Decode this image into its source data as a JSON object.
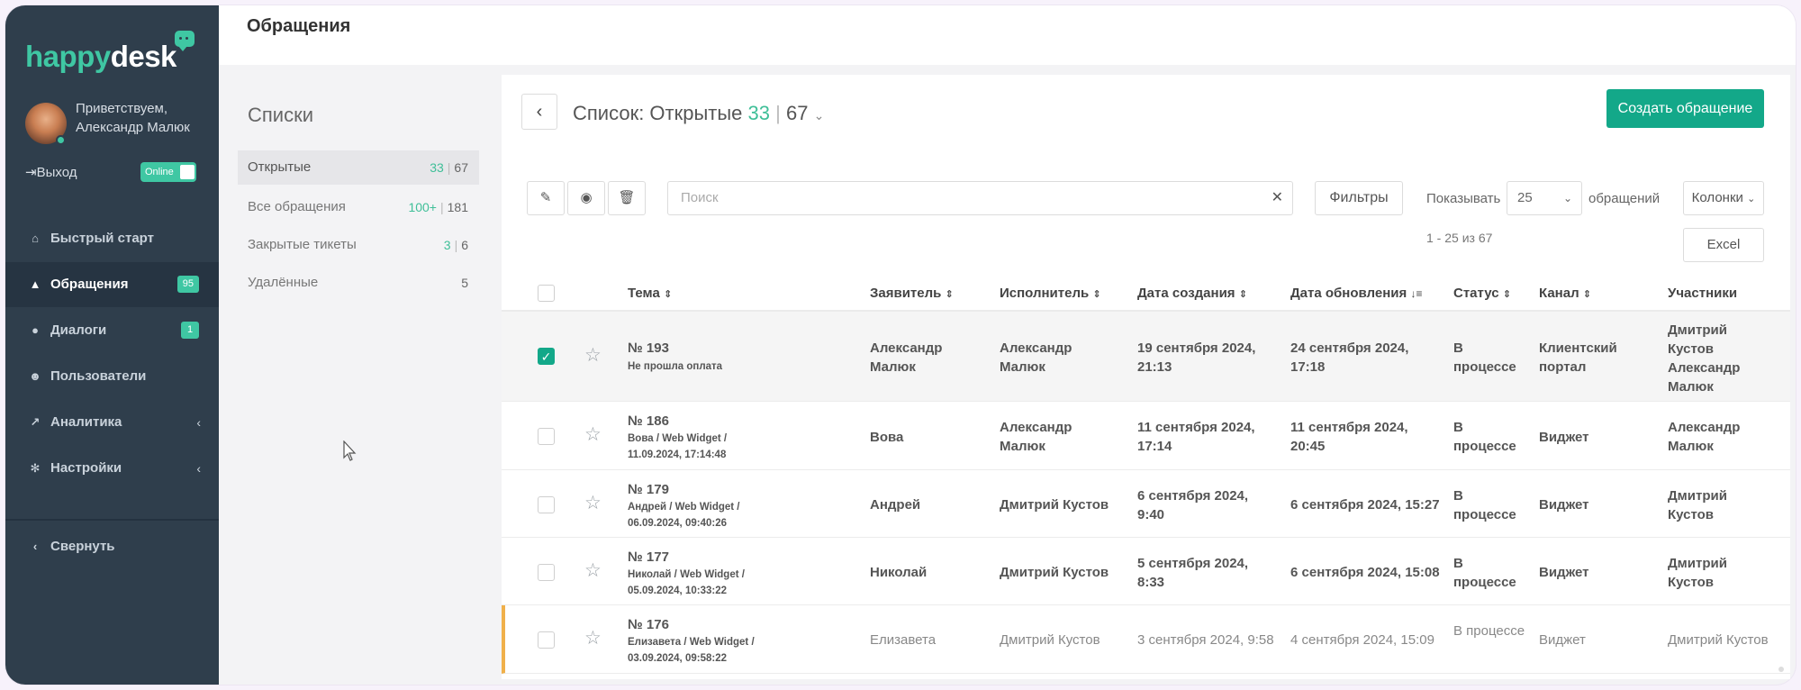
{
  "app": {
    "logo_part1": "happy",
    "logo_part2": "desk",
    "page_title": "Обращения"
  },
  "user": {
    "greeting": "Приветствуем, Александр Малюк",
    "logout": "Выход",
    "status": "Online"
  },
  "nav": [
    {
      "label": "Быстрый старт",
      "icon": "home-icon"
    },
    {
      "label": "Обращения",
      "icon": "warning-icon",
      "badge": "95"
    },
    {
      "label": "Диалоги",
      "icon": "chat-icon",
      "badge": "1"
    },
    {
      "label": "Пользователи",
      "icon": "users-icon"
    },
    {
      "label": "Аналитика",
      "icon": "chart-icon"
    },
    {
      "label": "Настройки",
      "icon": "gear-icon"
    }
  ],
  "collapse": "Свернуть",
  "lists": {
    "title": "Списки",
    "items": [
      {
        "label": "Открытые",
        "count_a": "33",
        "count_b": "67"
      },
      {
        "label": "Все обращения",
        "count_a": "100+",
        "count_b": "181"
      },
      {
        "label": "Закрытые тикеты",
        "count_a": "3",
        "count_b": "6"
      },
      {
        "label": "Удалённые",
        "count_b": "5"
      }
    ]
  },
  "listview": {
    "heading": "Список: Открытые",
    "count_open": "33",
    "count_total": "67",
    "create_label": "Создать обращение",
    "search_placeholder": "Поиск",
    "filters_label": "Фильтры",
    "show_label": "Показывать",
    "per_page": "25",
    "requests_label": "обращений",
    "columns_label": "Колонки",
    "range": "1 - 25 из 67",
    "excel_label": "Excel"
  },
  "table": {
    "headers": [
      "Тема",
      "Заявитель",
      "Исполнитель",
      "Дата создания",
      "Дата обновления",
      "Статус",
      "Канал",
      "Участники"
    ],
    "rows": [
      {
        "num": "№ 193",
        "subject1": "Не прошла оплата",
        "subject2": "",
        "applicant": "Александр Малюк",
        "assignee": "Александр Малюк",
        "created": "19 сентября 2024, 21:13",
        "updated": "24 сентября 2024, 17:18",
        "status": "В процессе",
        "channel": "Клиентский портал",
        "members": "Дмитрий Кустов Александр Малюк",
        "checked": true
      },
      {
        "num": "№ 186",
        "subject1": "Вова / Web Widget /",
        "subject2": "11.09.2024, 17:14:48",
        "applicant": "Вова",
        "assignee": "Александр Малюк",
        "created": "11 сентября 2024, 17:14",
        "updated": "11 сентября 2024, 20:45",
        "status": "В процессе",
        "channel": "Виджет",
        "members": "Александр Малюк",
        "checked": false
      },
      {
        "num": "№ 179",
        "subject1": "Андрей / Web Widget /",
        "subject2": "06.09.2024, 09:40:26",
        "applicant": "Андрей",
        "assignee": "Дмитрий Кустов",
        "created": "6 сентября 2024, 9:40",
        "updated": "6 сентября 2024, 15:27",
        "status": "В процессе",
        "channel": "Виджет",
        "members": "Дмитрий Кустов",
        "checked": false
      },
      {
        "num": "№ 177",
        "subject1": "Николай / Web Widget /",
        "subject2": "05.09.2024, 10:33:22",
        "applicant": "Николай",
        "assignee": "Дмитрий Кустов",
        "created": "5 сентября 2024, 8:33",
        "updated": "6 сентября 2024, 15:08",
        "status": "В процессе",
        "channel": "Виджет",
        "members": "Дмитрий Кустов",
        "checked": false
      },
      {
        "num": "№ 176",
        "subject1": "Елизавета / Web Widget /",
        "subject2": "03.09.2024, 09:58:22",
        "applicant": "Елизавета",
        "assignee": "Дмитрий Кустов",
        "created": "3 сентября 2024, 9:58",
        "updated": "4 сентября 2024, 15:09",
        "status": "В процессе",
        "channel": "Виджет",
        "members": "Дмитрий Кустов",
        "checked": false
      }
    ]
  }
}
